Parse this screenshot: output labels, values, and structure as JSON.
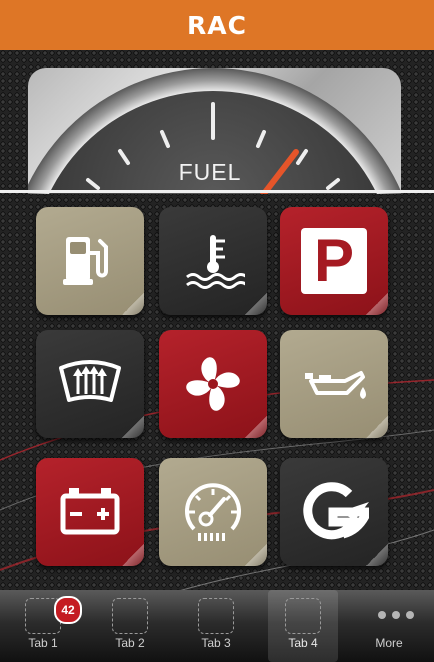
{
  "header": {
    "logo_text": "RAC",
    "background": "#de7626"
  },
  "gauge": {
    "label": "FUEL"
  },
  "tiles": [
    {
      "icon": "fuel-pump-icon",
      "color": "tan"
    },
    {
      "icon": "coolant-temperature-icon",
      "color": "dark"
    },
    {
      "icon": "parking-icon",
      "color": "red",
      "text": "P"
    },
    {
      "icon": "rear-defrost-icon",
      "color": "dark"
    },
    {
      "icon": "fan-icon",
      "color": "red"
    },
    {
      "icon": "oil-can-icon",
      "color": "tan"
    },
    {
      "icon": "battery-icon",
      "color": "red"
    },
    {
      "icon": "speedometer-icon",
      "color": "tan"
    },
    {
      "icon": "g-logo-icon",
      "color": "dark"
    }
  ],
  "tabbar": {
    "tabs": [
      {
        "label": "Tab 1",
        "badge": "42"
      },
      {
        "label": "Tab 2"
      },
      {
        "label": "Tab 3"
      },
      {
        "label": "Tab 4",
        "selected": true
      },
      {
        "label": "More"
      }
    ]
  }
}
